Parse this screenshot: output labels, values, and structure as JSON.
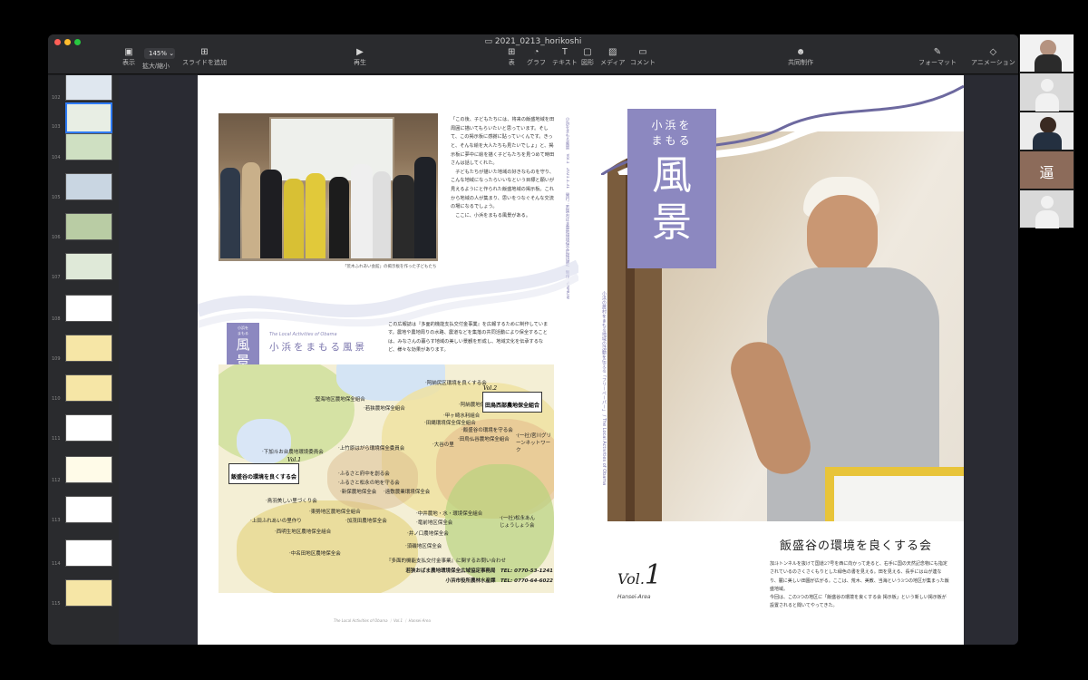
{
  "window": {
    "title": "2021_0213_horikoshi"
  },
  "toolbar": {
    "zoom": "145%",
    "view": "表示",
    "zoom_label": "拡大/縮小",
    "add_slide": "スライドを追加",
    "play": "再生",
    "table": "表",
    "chart": "グラフ",
    "text": "テキスト",
    "shape": "図形",
    "media": "メディア",
    "comment": "コメント",
    "collaborate": "共同制作",
    "format": "フォーマット",
    "animate": "アニメーション"
  },
  "sidebar": {
    "slides": [
      {
        "num": "102"
      },
      {
        "num": "103"
      },
      {
        "num": "104"
      },
      {
        "num": "105"
      },
      {
        "num": "106"
      },
      {
        "num": "107"
      },
      {
        "num": "108"
      },
      {
        "num": "109"
      },
      {
        "num": "110"
      },
      {
        "num": "111"
      },
      {
        "num": "112"
      },
      {
        "num": "113"
      },
      {
        "num": "114"
      },
      {
        "num": "115"
      }
    ],
    "selected": "103"
  },
  "slide": {
    "left": {
      "photo_caption": "「荒木ふれあい会館」の掲示板を作った子どもたち",
      "para1": "「この後、子どもたちには、将来の飯盛地域を田周囲に描いてもらいたいと思っています。そして、この掲示板に感謝に貼っていくんです。きっと、そんな絵を大人たちも見たいでしょ」と、掲示板に夢中に絵を描く子どもたちを見つめて時田さんは話してくれた。",
      "para2": "子どもたちが描いた地域の好きなものを守り、こんな地域になったらいいなという目標と願いが見えるようにと作られた飯盛地域の掲示板。これから地域の人が集まり、思いをつなぐそんな交流の場になるでしょう。",
      "para3": "ここに、小浜をまもる風景がある。",
      "vertical1": "小浜をまもる風景　Vol.1　2021.1.31　発行：若狭おばま農地環境保全広域協定　制作：UNMOW",
      "brand_en": "The Local Activities of Obama",
      "brand_jp": "小浜をまもる風景",
      "intro": "この広報誌は『多面的機能支払交付金事業』を広報するために制作しています。農地や農地周りの水路、農道などを集落の共同活動により保全することは、みなさんの暮らす地域の美しい景観を形成し、地域文化を伝承するなど、様々な効果があります。",
      "map": {
        "vol1_tag": "Vol.1",
        "vol1_name": "飯盛谷の環境を良くする会",
        "vol2_tag": "Vol.2",
        "vol2_name": "田烏西部農地保全組合",
        "labels": [
          "阿納尻区環境を良くする会",
          "堅海地区農地保全組合",
          "若狭農地保全組合",
          "阿納農地保全組合",
          "甲ヶ崎水利組合",
          "田縄環境保全保全組合",
          "飯盛谷の環境を守る会",
          "田烏仏谷農地保全組合",
          "上竹原はがら環境保全委員会",
          "大谷の里",
          "(一社)宮川グリーンネットワーク",
          "下加斗お台農地環境委員会",
          "岡津地区環境保全会",
          "ふるさと府中を創る会",
          "ふるさと松永の地を守る会",
          "遠敷農業環境保全会",
          "新保農地保全会",
          "東勢地区農地保全組合",
          "鳥羽美しい里づくり会",
          "上田ふれあいの里作り",
          "中井農地・水・環境保全組合",
          "竜前地区保全会",
          "加茂田農地保全会",
          "井ノ口農地保全会",
          "須磯地区保全会",
          "西明生地区農地保全組合",
          "中名田地区農地保全会",
          "(一社)松永あんじょうしょう会"
        ],
        "contact_title": "『多面的機能支払交付金事業』に関するお問い合わせ",
        "contact1_name": "若狭おばま農地環境保全広域協定事務局",
        "contact1_tel": "TEL: 0770-53-1241",
        "contact2_name": "小浜市役所農林水産課",
        "contact2_tel": "TEL: 0770-64-6022"
      },
      "footer": "The Local Activities of Obama ｜ Vol.1 ｜ Hansei-Area"
    },
    "right": {
      "badge_top": "小浜を\nまもる",
      "badge_kanji1": "風",
      "badge_kanji2": "景",
      "vertical_caption": "小浜の農村をまもる地域の活動を伝える「フリーペーパー」 / The Local Activities of Obama",
      "vol_label": "Vol.",
      "vol_num": "1",
      "vol_sub": "Hansei-Area",
      "heading": "飯盛谷の環境を良くする会",
      "body1": "加斗トンネルを抜けて国道27号を西に向かって走ると、右手に国の天然記念物にも指定されているのさくさくもりとした緑色の書を見える。田を見える、長手には山が連なり、麓に美しい田園が広がる。ここは、荒木、美教、当海という3つの地区が集まった飯盛地域。",
      "body2": "今回は、この3つの地区に「飯盛谷の環境を良くする会 掲示板」という新しい掲示板が設置されると聞いてやってきた。"
    }
  },
  "participants": {
    "tile3_initial": "逼"
  }
}
